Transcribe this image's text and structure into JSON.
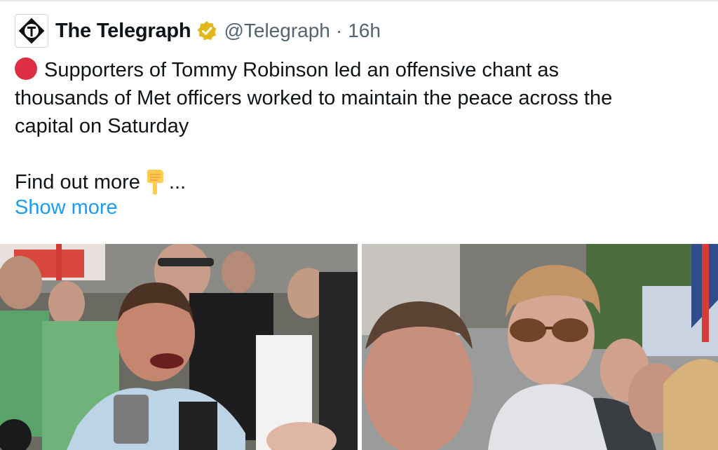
{
  "post": {
    "author_name": "The Telegraph",
    "handle": "@Telegraph",
    "separator": "·",
    "time": "16h",
    "text_lines": [
      "Supporters of Tommy Robinson led an offensive chant as",
      "thousands of Met officers worked to maintain the peace across the",
      "capital on Saturday"
    ],
    "find_out_more": "Find out more",
    "ellipsis": "...",
    "show_more": "Show more"
  },
  "icons": {
    "avatar": "telegraph-logo",
    "verified": "gold-verified-badge",
    "status": "red-circle-emoji",
    "pointer": "backhand-index-pointing-down-emoji"
  },
  "media": {
    "left_photo": "crowd-photo-man-shouting",
    "right_photo": "crowd-photo-man-with-sunglasses"
  },
  "colors": {
    "text": "#0f1419",
    "secondary": "#536471",
    "link": "#1d9bf0",
    "verified_gold": "#e2b719",
    "red_circle": "#dd2e44"
  }
}
